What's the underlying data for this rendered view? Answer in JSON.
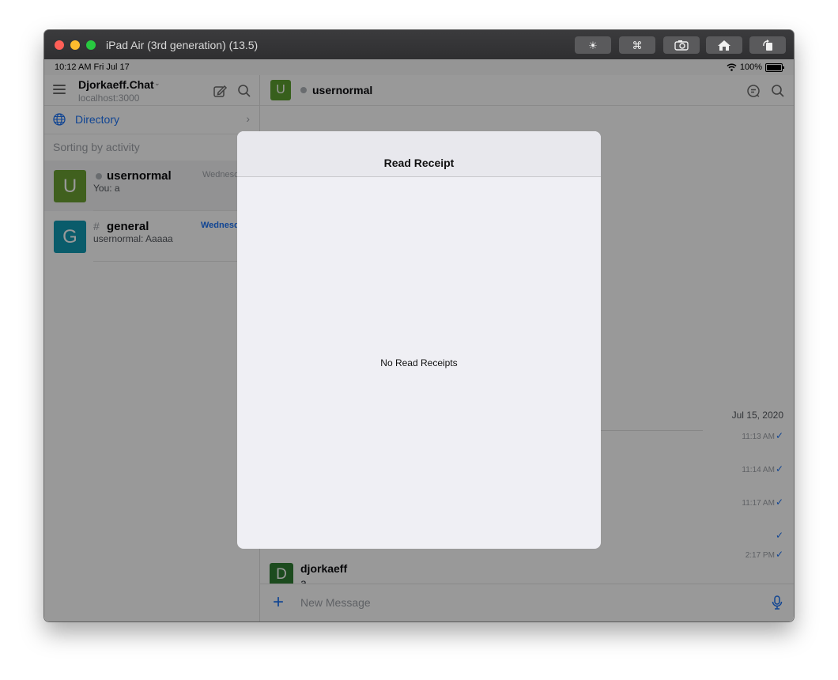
{
  "window": {
    "title": "iPad Air (3rd generation) (13.5)",
    "toolbar": [
      {
        "name": "brightness-icon",
        "glyph": "☀"
      },
      {
        "name": "command-icon",
        "glyph": "⌘"
      },
      {
        "name": "screenshot-icon",
        "glyph": "📷"
      },
      {
        "name": "home-icon",
        "glyph": "⌂"
      },
      {
        "name": "rotate-icon",
        "glyph": "⟲"
      }
    ]
  },
  "statusbar": {
    "time": "10:12 AM  Fri Jul 17",
    "battery": "100%"
  },
  "sidebar": {
    "server_name": "Djorkaeff.Chat",
    "server_host": "localhost:3000",
    "directory_label": "Directory",
    "sorting_label": "Sorting by activity",
    "rooms": [
      {
        "avatar": "U",
        "avatar_color": "#6ba132",
        "name": "usernormal",
        "last_message": "You: a",
        "date": "Wednesday"
      },
      {
        "avatar": "G",
        "avatar_color": "#1199b3",
        "name": "general",
        "last_message": "usernormal: Aaaaa",
        "date": "Wednesday"
      }
    ]
  },
  "chat": {
    "avatar": "U",
    "title": "usernormal",
    "date_divider": "Jul 15, 2020",
    "message_times": [
      "11:13 AM",
      "11:14 AM",
      "11:17 AM",
      "",
      "2:17 PM"
    ],
    "last_message": {
      "avatar": "D",
      "user": "djorkaeff",
      "text": "a"
    },
    "composer_placeholder": "New Message"
  },
  "modal": {
    "title": "Read Receipt",
    "empty_text": "No Read Receipts"
  },
  "colors": {
    "accent": "#1d74f5",
    "overlay": "rgba(0,0,0,0.40)"
  }
}
